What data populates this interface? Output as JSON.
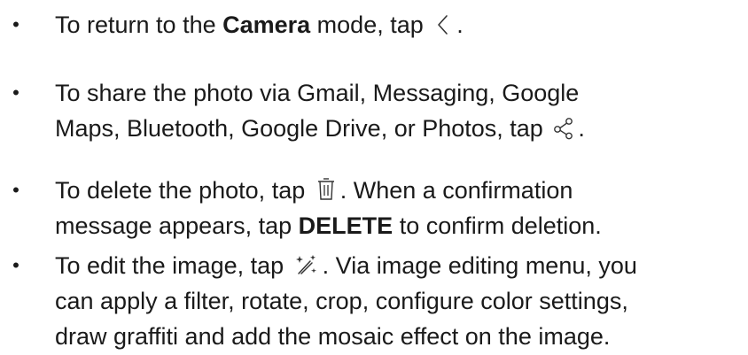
{
  "items": [
    {
      "t1": "To return to the ",
      "b1": "Camera",
      "t2": " mode, tap ",
      "icon": "back-chevron-icon",
      "t3": "."
    },
    {
      "line1": "To share the photo via Gmail, Messaging, Google",
      "line2a": "Maps, Bluetooth, Google Drive, or Photos, tap ",
      "icon": "share-icon",
      "line2b": "."
    },
    {
      "t1": "To delete the photo, tap ",
      "icon": "trash-icon",
      "t2": ". When a confirmation",
      "t3": "message appears, tap ",
      "b1": "DELETE",
      "t4": " to confirm deletion."
    },
    {
      "t1": "To edit the image, tap ",
      "icon": "magic-wand-icon",
      "t2": ". Via image editing menu, you",
      "line2": "can apply a filter, rotate, crop, configure color settings,",
      "line3": "draw graffiti and add the mosaic effect on the image."
    }
  ],
  "bullet": "•"
}
